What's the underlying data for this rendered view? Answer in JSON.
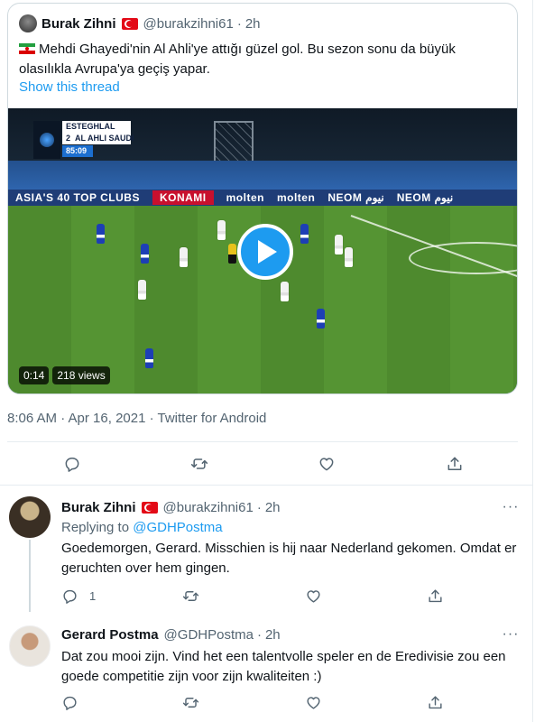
{
  "quoted_tweet": {
    "author_name": "Burak Zihni",
    "handle": "@burakzihni61",
    "separator": "·",
    "time": "2h",
    "text": "Mehdi Ghayedi'nin Al Ahli'ye attığı güzel gol. Bu sezon sonu da büyük olasılıkla Avrupa'ya geçiş yapar.",
    "show_thread": "Show this thread",
    "video": {
      "duration": "0:14",
      "views": "218 views",
      "scorebug": {
        "team1": "ESTEGHLAL",
        "score": "2",
        "team2": "AL AHLI SAUDI",
        "clock": "85:09"
      },
      "ad_texts": [
        "ASIA'S 40 TOP CLUBS",
        "KONAMI",
        "molten",
        "molten",
        "NEOM نيوم",
        "NEOM نيوم"
      ]
    }
  },
  "timestamp": "8:06 AM · Apr 16, 2021 · Twitter for Android",
  "action_icons": [
    "reply-icon",
    "retweet-icon",
    "like-icon",
    "share-icon"
  ],
  "replies": [
    {
      "author_name": "Burak Zihni",
      "handle": "@burakzihni61",
      "separator": "·",
      "time": "2h",
      "replying_label": "Replying to",
      "replying_handle": "@GDHPostma",
      "text": "Goedemorgen, Gerard. Misschien is hij naar Nederland gekomen. Omdat er geruchten over hem gingen.",
      "reply_count": "1",
      "more": "···"
    },
    {
      "author_name": "Gerard Postma",
      "handle": "@GDHPostma",
      "separator": "·",
      "time": "2h",
      "text": "Dat zou mooi zijn. Vind het een talentvolle speler en de Eredivisie zou een goede competitie zijn voor zijn kwaliteiten :)",
      "more": "···"
    }
  ],
  "colors": {
    "accent": "#1d9bf0",
    "text": "#0f1419",
    "muted": "#536471",
    "border": "#cfd9de"
  }
}
